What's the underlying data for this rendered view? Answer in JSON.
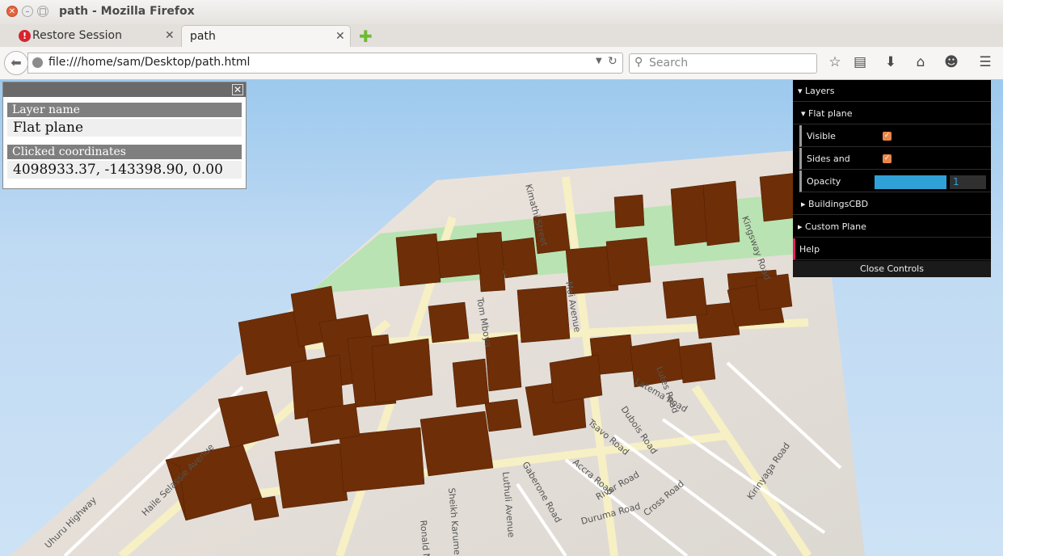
{
  "window": {
    "title": "path - Mozilla Firefox"
  },
  "tabs": [
    {
      "label": "Restore Session"
    },
    {
      "label": "path"
    }
  ],
  "nav": {
    "url": "file:///home/sam/Desktop/path.html",
    "search_placeholder": "Search"
  },
  "info_panel": {
    "layer_name_label": "Layer name",
    "layer_name_value": "Flat plane",
    "coords_label": "Clicked coordinates",
    "coords_value": "4098933.37, -143398.90, 0.00"
  },
  "controls": {
    "layers": "Layers",
    "flat_plane": "Flat plane",
    "visible_label": "Visible",
    "visible_checked": true,
    "sides_label": "Sides and",
    "sides_checked": true,
    "opacity_label": "Opacity",
    "opacity_value": "1",
    "buildings": "BuildingsCBD",
    "custom_plane": "Custom Plane",
    "help": "Help",
    "close": "Close Controls"
  },
  "map_labels": [
    "Kingsway Road",
    "Lutes Road",
    "Latema Road",
    "Tsavo Road",
    "Dubois Road",
    "Accra Road",
    "Gaberone Road",
    "Luthuli Avenue",
    "Sheikh Karume Road",
    "River Road",
    "Cross Road",
    "Duruma Road",
    "Kirinyaga Road",
    "Ronald Ngala",
    "Tom Mboya",
    "Moi Avenue",
    "Kimathi Street",
    "Haile Selassie Avenue",
    "Uhuru Highway"
  ],
  "colors": {
    "building": "#6e2e07",
    "sky_top": "#9cc9ee",
    "gui_bg": "#000000",
    "gui_accent": "#2fa1d6",
    "checkbox": "#e8864a"
  }
}
